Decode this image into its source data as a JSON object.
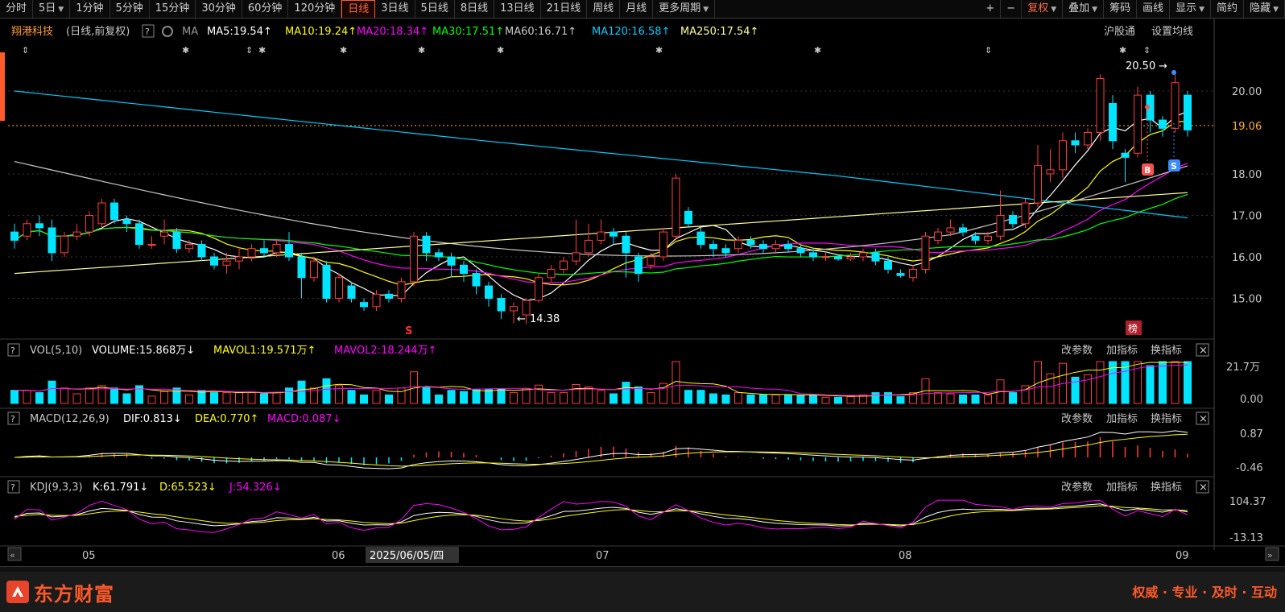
{
  "toolbar": {
    "periods": [
      "分时",
      "5日",
      "1分钟",
      "5分钟",
      "15分钟",
      "30分钟",
      "60分钟",
      "120分钟",
      "日线",
      "3日线",
      "5日线",
      "8日线",
      "13日线",
      "21日线",
      "周线",
      "月线",
      "更多周期"
    ],
    "active_period": "日线",
    "plus": "+",
    "minus": "−",
    "fuquan": "复权",
    "diejia": "叠加",
    "chouma": "筹码",
    "huaxian": "画线",
    "xianshi": "显示",
    "jianyue": "简约",
    "yincang": "隐藏"
  },
  "main": {
    "stock_name": "翔港科技",
    "subtitle": "(日线,前复权)",
    "help": "?",
    "ma_label": "MA",
    "ma_items": [
      {
        "label": "MA5:19.54",
        "arrow": "↑",
        "color": "#ffffff"
      },
      {
        "label": "MA10:19.24",
        "arrow": "↑",
        "color": "#ffff00"
      },
      {
        "label": "MA20:18.34",
        "arrow": "↑",
        "color": "#ff00ff"
      },
      {
        "label": "MA30:17.51",
        "arrow": "↑",
        "color": "#00ff00"
      },
      {
        "label": "MA60:16.71",
        "arrow": "↑",
        "color": "#c8c8c8"
      },
      {
        "label": "MA120:16.58",
        "arrow": "↑",
        "color": "#00ccff"
      },
      {
        "label": "MA250:17.54",
        "arrow": "↑",
        "color": "#ffff99"
      }
    ],
    "hugutong": "沪股通",
    "set_ma": "设置均线",
    "price_ticks": [
      "20.00",
      "19.06",
      "18.00",
      "17.00",
      "16.00",
      "15.00"
    ],
    "current_price": "19.06",
    "high_label": "20.50",
    "low_label": "14.38",
    "marker_s_red": "S",
    "marker_b": "B",
    "marker_s_blue": "S",
    "marker_bang": "榜"
  },
  "vol": {
    "name": "VOL(5,10)",
    "volume": "VOLUME:15.868万",
    "volume_arrow": "↓",
    "mavol1": "MAVOL1:19.571万",
    "mavol1_arrow": "↑",
    "mavol2": "MAVOL2:18.244万",
    "mavol2_arrow": "↑",
    "ticks": [
      "21.7万",
      "0.00"
    ]
  },
  "macd": {
    "name": "MACD(12,26,9)",
    "dif": "DIF:0.813",
    "dif_arrow": "↓",
    "dea": "DEA:0.770",
    "dea_arrow": "↑",
    "macd": "MACD:0.087",
    "macd_arrow": "↓",
    "ticks": [
      "0.87",
      "-0.46"
    ]
  },
  "kdj": {
    "name": "KDJ(9,3,3)",
    "k": "K:61.791",
    "k_arrow": "↓",
    "d": "D:65.523",
    "d_arrow": "↓",
    "j": "J:54.326",
    "j_arrow": "↓",
    "ticks": [
      "104.37",
      "-13.13"
    ]
  },
  "panel_buttons": {
    "params": "改参数",
    "add": "加指标",
    "switch": "换指标",
    "close": "×"
  },
  "xaxis": {
    "labels": [
      "05",
      "06",
      "07",
      "08",
      "09"
    ],
    "cursor_date": "2025/06/05/四"
  },
  "footer": {
    "brand": "东方财富",
    "slogan": "权威 · 专业 · 及时 · 互动"
  },
  "colors": {
    "up": "#ff3c3c",
    "down": "#00e5ff",
    "bg": "#000000",
    "accent": "#ff5a2a"
  }
}
